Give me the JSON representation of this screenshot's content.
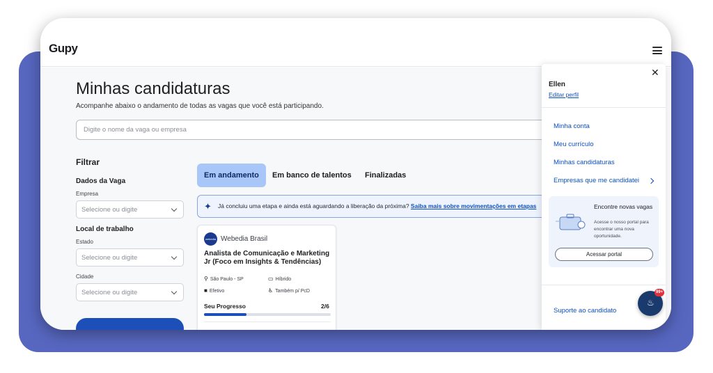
{
  "colors": {
    "accent": "#1d4fb8",
    "backdrop": "#5767c0",
    "tab_active": "#a8c6f8",
    "link": "#0b4fc4",
    "fab": "#1a3a6e",
    "badge": "#e0323c"
  },
  "header": {
    "logo": "Gupy",
    "menu_icon": "hamburger-icon"
  },
  "page": {
    "title": "Minhas candidaturas",
    "subtitle": "Acompanhe abaixo o andamento de todas as vagas que você está participando.",
    "search_placeholder": "Digite o nome da vaga ou empresa"
  },
  "filters": {
    "title": "Filtrar",
    "job_data_label": "Dados da Vaga",
    "company_label": "Empresa",
    "company_placeholder": "Selecione ou digite",
    "location_label": "Local de trabalho",
    "state_label": "Estado",
    "state_placeholder": "Selecione ou digite",
    "city_label": "Cidade",
    "city_placeholder": "Selecione ou digite"
  },
  "tabs": [
    {
      "label": "Em andamento",
      "active": true
    },
    {
      "label": "Em banco de talentos",
      "active": false
    },
    {
      "label": "Finalizadas",
      "active": false
    }
  ],
  "info_banner": {
    "icon": "sparkle-icon",
    "text": "Já concluiu uma etapa e ainda está aguardando a liberação da próxima? ",
    "link": "Saiba mais sobre movimentações em etapas"
  },
  "application_card": {
    "company": "Webedia Brasil",
    "company_logo_text": "webedia",
    "job_title": "Analista de Comunicação e Marketing Jr (Foco em Insights & Tendências)",
    "location": "São Paulo - SP",
    "workplace": "Híbrido",
    "contract": "Efetivo",
    "pcd": "Também p/ PcD",
    "progress_label": "Seu Progresso",
    "progress_text": "2/6",
    "progress_fraction": 0.333
  },
  "menu": {
    "user_name": "Ellen",
    "edit_profile": "Editar perfil",
    "items": [
      "Minha conta",
      "Meu currículo",
      "Minhas candidaturas",
      "Empresas que me candidatei"
    ],
    "promo": {
      "title": "Encontre novas vagas",
      "description": "Acesse o nosso portal para encontrar uma nova oportunidade.",
      "button": "Acessar portal"
    },
    "support": "Suporte ao candidato"
  },
  "fab": {
    "badge": "99+",
    "icon": "flame-icon"
  }
}
